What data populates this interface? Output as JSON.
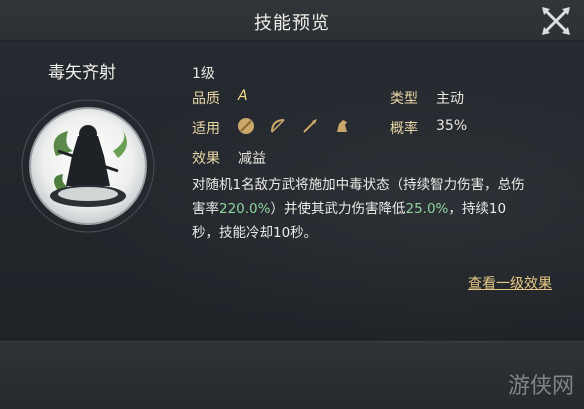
{
  "header": {
    "title": "技能预览"
  },
  "skill": {
    "name": "毒矢齐射",
    "level": "1级",
    "quality_label": "品质",
    "quality_value": "A",
    "type_label": "类型",
    "type_value": "主动",
    "applies_label": "适用",
    "applies_icons": [
      "shield-icon",
      "bow-icon",
      "spear-icon",
      "horse-icon"
    ],
    "chance_label": "概率",
    "chance_value": "35%",
    "effect_label": "效果",
    "effect_value": "减益",
    "desc": {
      "p1": "对随机1名敌方武将施加中毒状态（持续智力伤害，总伤害率",
      "v1": "220.0%",
      "p2": "）并使其武力伤害降低",
      "v2": "25.0%",
      "p3": "，持续10秒，技能冷却10秒。"
    },
    "detail_link": "查看一级效果"
  },
  "watermark": "游侠网"
}
